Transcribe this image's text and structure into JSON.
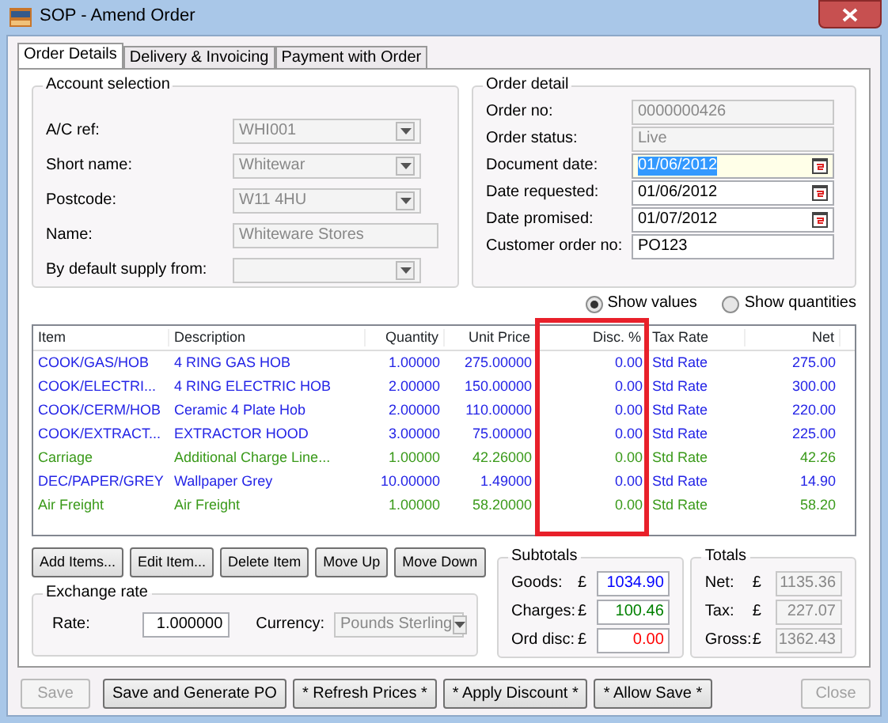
{
  "window": {
    "title": "SOP - Amend Order"
  },
  "tabs": [
    {
      "label": "Order Details",
      "selected": true
    },
    {
      "label": "Delivery & Invoicing",
      "selected": false
    },
    {
      "label": "Payment with Order",
      "selected": false
    }
  ],
  "account_selection": {
    "title": "Account selection",
    "fields": [
      {
        "label": "A/C ref:",
        "value": "WHI001",
        "kind": "combo",
        "disabled": true
      },
      {
        "label": "Short name:",
        "value": "Whitewar",
        "kind": "combo",
        "disabled": true
      },
      {
        "label": "Postcode:",
        "value": "W11 4HU",
        "kind": "combo",
        "disabled": true
      },
      {
        "label": "Name:",
        "value": "Whiteware Stores",
        "kind": "text",
        "disabled": true
      },
      {
        "label": "By default supply from:",
        "kind": "combo",
        "disabled": true
      }
    ]
  },
  "order_detail": {
    "title": "Order detail",
    "fields": [
      {
        "label": "Order no:",
        "value": "0000000426",
        "kind": "text",
        "disabled": true,
        "highlighted": false
      },
      {
        "label": "Order status:",
        "value": "Live",
        "kind": "text",
        "disabled": true,
        "highlighted": false
      },
      {
        "label": "Document date:",
        "value": "01/06/2012",
        "kind": "date",
        "disabled": false,
        "highlighted": true
      },
      {
        "label": "Date requested:",
        "value": "01/06/2012",
        "kind": "date",
        "disabled": false,
        "highlighted": false
      },
      {
        "label": "Date promised:",
        "value": "01/07/2012",
        "kind": "date",
        "disabled": false,
        "highlighted": false
      },
      {
        "label": "Customer order no:",
        "value": "PO123",
        "kind": "text",
        "disabled": false,
        "highlighted": false
      }
    ]
  },
  "view_options": [
    {
      "label": "Show values",
      "selected": true
    },
    {
      "label": "Show quantities",
      "selected": false
    }
  ],
  "table": {
    "columns": [
      "Item",
      "Description",
      "Quantity",
      "Unit Price",
      "Disc. %",
      "Tax Rate",
      "Net"
    ],
    "rows": [
      {
        "kind": "item",
        "cells": [
          "COOK/GAS/HOB",
          "4 RING GAS HOB",
          "1.00000",
          "275.00000",
          "0.00",
          "Std Rate",
          "275.00"
        ]
      },
      {
        "kind": "item",
        "cells": [
          "COOK/ELECTRI...",
          "4 RING ELECTRIC HOB",
          "2.00000",
          "150.00000",
          "0.00",
          "Std Rate",
          "300.00"
        ]
      },
      {
        "kind": "item",
        "cells": [
          "COOK/CERM/HOB",
          "Ceramic 4 Plate Hob",
          "2.00000",
          "110.00000",
          "0.00",
          "Std Rate",
          "220.00"
        ]
      },
      {
        "kind": "item",
        "cells": [
          "COOK/EXTRACT...",
          "EXTRACTOR HOOD",
          "3.00000",
          "75.00000",
          "0.00",
          "Std Rate",
          "225.00"
        ]
      },
      {
        "kind": "charge",
        "cells": [
          "Carriage",
          "Additional Charge Line...",
          "1.00000",
          "42.26000",
          "0.00",
          "Std Rate",
          "42.26"
        ]
      },
      {
        "kind": "item",
        "cells": [
          "DEC/PAPER/GREY",
          "Wallpaper Grey",
          "10.00000",
          "1.49000",
          "0.00",
          "Std Rate",
          "14.90"
        ]
      },
      {
        "kind": "charge",
        "cells": [
          "Air Freight",
          "Air Freight",
          "1.00000",
          "58.20000",
          "0.00",
          "Std Rate",
          "58.20"
        ]
      }
    ]
  },
  "item_buttons": [
    "Add Items...",
    "Edit Item...",
    "Delete Item",
    "Move Up",
    "Move Down"
  ],
  "exchange_rate": {
    "title": "Exchange rate",
    "rate_label": "Rate:",
    "rate": "1.000000",
    "currency_label": "Currency:",
    "currency": "Pounds Sterling"
  },
  "subtotals": {
    "title": "Subtotals",
    "rows": [
      {
        "label": "Goods:",
        "currency": "£",
        "value": "1034.90",
        "color": "#0000ff"
      },
      {
        "label": "Charges:",
        "currency": "£",
        "value": "100.46",
        "color": "#008000"
      },
      {
        "label": "Ord disc:",
        "currency": "£",
        "value": "0.00",
        "color": "#ff0000"
      }
    ]
  },
  "totals": {
    "title": "Totals",
    "rows": [
      {
        "label": "Net:",
        "currency": "£",
        "value": "1135.36"
      },
      {
        "label": "Tax:",
        "currency": "£",
        "value": "227.07"
      },
      {
        "label": "Gross:",
        "currency": "£",
        "value": "1362.43"
      }
    ]
  },
  "footer_buttons": [
    {
      "label": "Save",
      "disabled": true
    },
    {
      "label": "Save and Generate PO",
      "disabled": false
    },
    {
      "label": "* Refresh Prices *",
      "disabled": false
    },
    {
      "label": "* Apply Discount *",
      "disabled": false
    },
    {
      "label": "* Allow Save *",
      "disabled": false
    },
    {
      "label": "Close",
      "disabled": true
    }
  ]
}
